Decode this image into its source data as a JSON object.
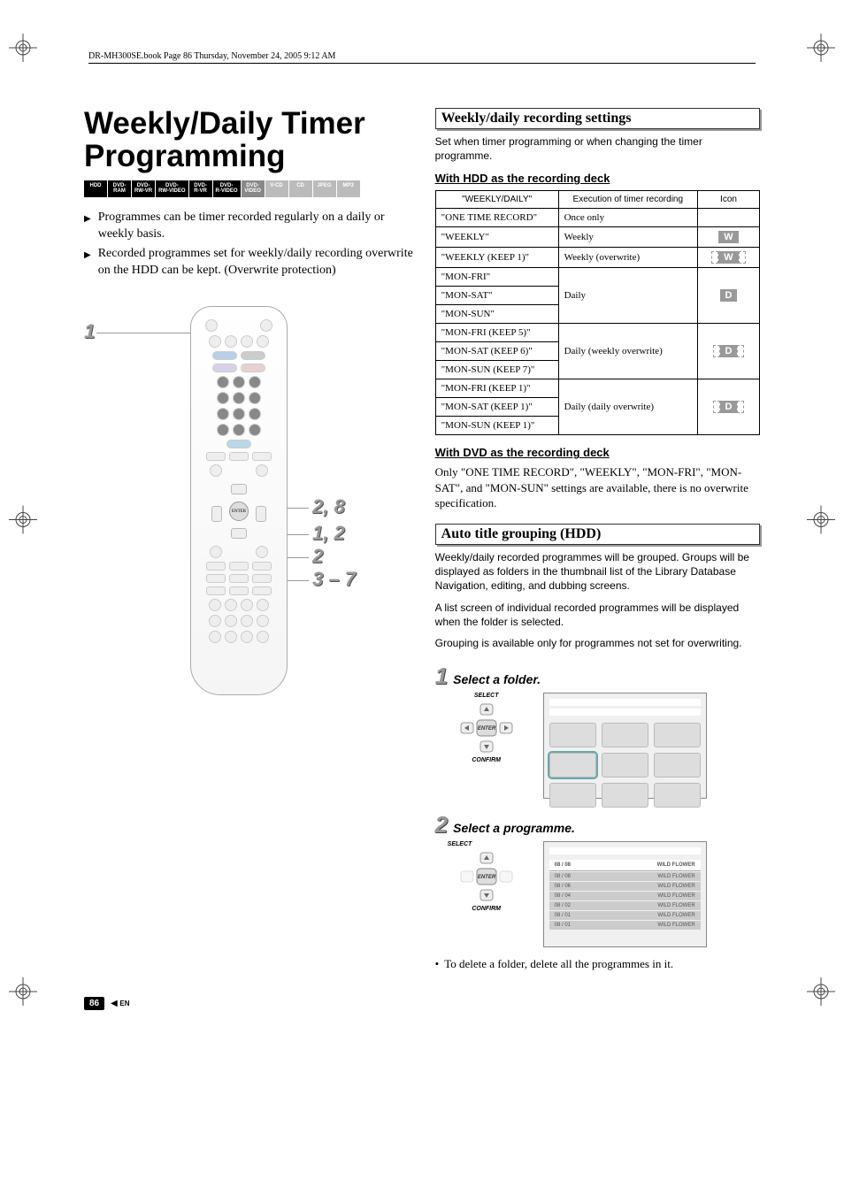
{
  "header_line": "DR-MH300SE.book  Page 86  Thursday, November 24, 2005  9:12 AM",
  "title_line1": "Weekly/Daily Timer",
  "title_line2": "Programming",
  "format_badges": [
    "HDD",
    "DVD-\nRAM",
    "DVD-\nRW-VR",
    "DVD-\nRW-VIDEO",
    "DVD-\nR-VR",
    "DVD-\nR-VIDEO",
    "DVD-\nVIDEO",
    "V-CD",
    "CD",
    "JPEG",
    "MP3"
  ],
  "bullets": [
    "Programmes can be timer recorded regularly on a daily or weekly basis.",
    "Recorded programmes set for weekly/daily recording overwrite on the HDD can be kept. (Overwrite protection)"
  ],
  "remote_labels": {
    "top_left": "1",
    "r1": "2, 8",
    "r2": "1, 2",
    "r3": "2",
    "r4": "3 – 7"
  },
  "right": {
    "sec1_title": "Weekly/daily recording settings",
    "sec1_para": "Set when timer programming or when changing the timer programme.",
    "hdd_subhead": "With HDD as the recording deck",
    "table_headers": [
      "\"WEEKLY/DAILY\"",
      "Execution of timer recording",
      "Icon"
    ],
    "table_rows": [
      {
        "names": [
          "\"ONE TIME RECORD\""
        ],
        "exec": "Once only",
        "icon": ""
      },
      {
        "names": [
          "\"WEEKLY\""
        ],
        "exec": "Weekly",
        "icon": "W",
        "dashed": false
      },
      {
        "names": [
          "\"WEEKLY (KEEP 1)\""
        ],
        "exec": "Weekly (overwrite)",
        "icon": "W",
        "dashed": true
      },
      {
        "names": [
          "\"MON-FRI\"",
          "\"MON-SAT\"",
          "\"MON-SUN\""
        ],
        "exec": "Daily",
        "icon": "D",
        "dashed": false
      },
      {
        "names": [
          "\"MON-FRI (KEEP 5)\"",
          "\"MON-SAT (KEEP 6)\"",
          "\"MON-SUN (KEEP 7)\""
        ],
        "exec": "Daily (weekly overwrite)",
        "icon": "D",
        "dashed": true
      },
      {
        "names": [
          "\"MON-FRI (KEEP 1)\"",
          "\"MON-SAT (KEEP 1)\"",
          "\"MON-SUN (KEEP 1)\""
        ],
        "exec": "Daily (daily overwrite)",
        "icon": "D",
        "dashed": true
      }
    ],
    "dvd_subhead": "With DVD as the recording deck",
    "dvd_para": "Only \"ONE TIME RECORD\", \"WEEKLY\", \"MON-FRI\", \"MON-SAT\", and \"MON-SUN\" settings are available, there is no overwrite specification.",
    "sec2_title": "Auto title grouping (HDD)",
    "sec2_paras": [
      "Weekly/daily recorded programmes will be grouped. Groups will be displayed as folders in the thumbnail list of the Library Database Navigation, editing, and dubbing screens.",
      "A list screen of individual recorded programmes will be displayed when the folder is selected.",
      "Grouping is available only for programmes not set for overwriting."
    ],
    "step1_num": "1",
    "step1_text": "Select a folder.",
    "step2_num": "2",
    "step2_text": "Select a programme.",
    "select_label": "SELECT",
    "confirm_label": "CONFIRM",
    "enter_label": "ENTER",
    "listview_header_left": "08 / 08",
    "listview_header_right": "WILD FLOWER",
    "listview_rows": [
      {
        "l": "08 / 08",
        "r": "WILD FLOWER"
      },
      {
        "l": "08 / 06",
        "r": "WILD FLOWER"
      },
      {
        "l": "08 / 04",
        "r": "WILD FLOWER"
      },
      {
        "l": "08 / 02",
        "r": "WILD FLOWER"
      },
      {
        "l": "08 / 01",
        "r": "WILD FLOWER"
      },
      {
        "l": "08 / 01",
        "r": "WILD FLOWER"
      }
    ],
    "note": "To delete a folder, delete all the programmes in it."
  },
  "footer": {
    "page": "86",
    "lang": "EN"
  }
}
